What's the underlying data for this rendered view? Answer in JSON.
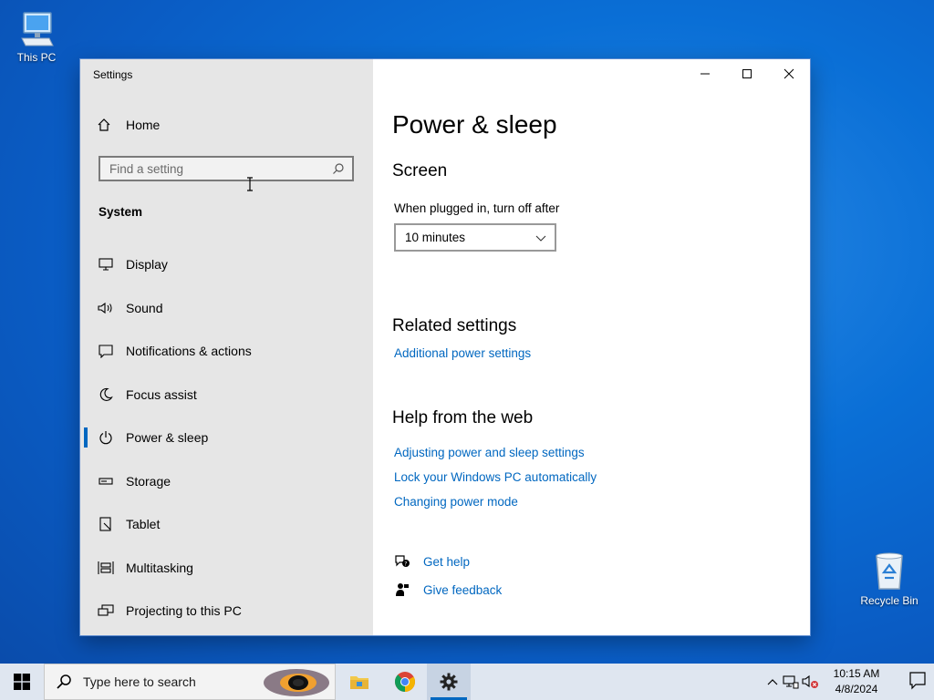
{
  "desktop": {
    "icons": [
      {
        "label": "This PC"
      },
      {
        "label": "Recycle Bin"
      }
    ]
  },
  "window": {
    "title": "Settings",
    "controls": {
      "minimize": "minimize-icon",
      "maximize": "maximize-icon",
      "close": "close-icon"
    }
  },
  "sidebar": {
    "home_label": "Home",
    "search_placeholder": "Find a setting",
    "section_label": "System",
    "items": [
      {
        "label": "Display",
        "icon": "monitor-icon"
      },
      {
        "label": "Sound",
        "icon": "speaker-icon"
      },
      {
        "label": "Notifications & actions",
        "icon": "notification-icon"
      },
      {
        "label": "Focus assist",
        "icon": "moon-icon"
      },
      {
        "label": "Power & sleep",
        "icon": "power-icon",
        "active": true
      },
      {
        "label": "Storage",
        "icon": "storage-icon"
      },
      {
        "label": "Tablet",
        "icon": "tablet-icon"
      },
      {
        "label": "Multitasking",
        "icon": "multitasking-icon"
      },
      {
        "label": "Projecting to this PC",
        "icon": "projecting-icon"
      }
    ]
  },
  "content": {
    "title": "Power & sleep",
    "screen_heading": "Screen",
    "screen_label": "When plugged in, turn off after",
    "screen_value": "10 minutes",
    "related_heading": "Related settings",
    "related_link": "Additional power settings",
    "help_heading": "Help from the web",
    "help_links": [
      "Adjusting power and sleep settings",
      "Lock your Windows PC automatically",
      "Changing power mode"
    ],
    "get_help": "Get help",
    "give_feedback": "Give feedback"
  },
  "taskbar": {
    "search_placeholder": "Type here to search",
    "apps": [
      "file-explorer-icon",
      "chrome-icon",
      "settings-gear-icon"
    ],
    "time": "10:15 AM",
    "date": "4/8/2024"
  },
  "colors": {
    "accent": "#0067c0",
    "sidebar_bg": "#e6e6e6",
    "taskbar_bg": "#dfe6f0"
  }
}
